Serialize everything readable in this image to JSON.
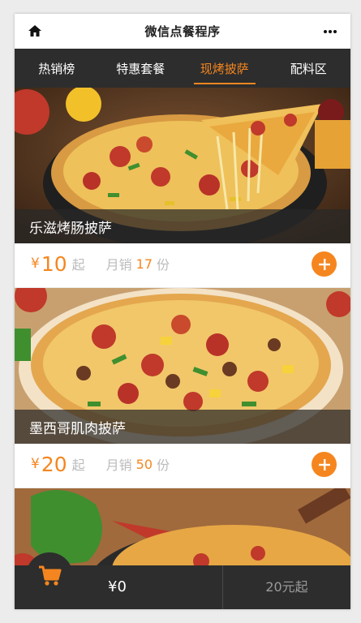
{
  "app": {
    "title": "微信点餐程序"
  },
  "header": {
    "home_icon": "home-icon",
    "more_icon": "more-icon"
  },
  "tabs": [
    {
      "label": "热销榜",
      "active": false
    },
    {
      "label": "特惠套餐",
      "active": false
    },
    {
      "label": "现烤披萨",
      "active": true
    },
    {
      "label": "配料区",
      "active": false
    }
  ],
  "items": [
    {
      "name": "乐滋烤肠披萨",
      "currency": "¥",
      "price": "10",
      "price_unit": "起",
      "sold_label": "月销",
      "sold": "17",
      "sold_unit": "份"
    },
    {
      "name": "墨西哥肌肉披萨",
      "currency": "¥",
      "price": "20",
      "price_unit": "起",
      "sold_label": "月销",
      "sold": "50",
      "sold_unit": "份"
    }
  ],
  "cart": {
    "total": "¥0",
    "min_order": "20元起",
    "icon": "cart-icon"
  },
  "colors": {
    "accent": "#f5861f",
    "bar": "#2d2d2d"
  }
}
